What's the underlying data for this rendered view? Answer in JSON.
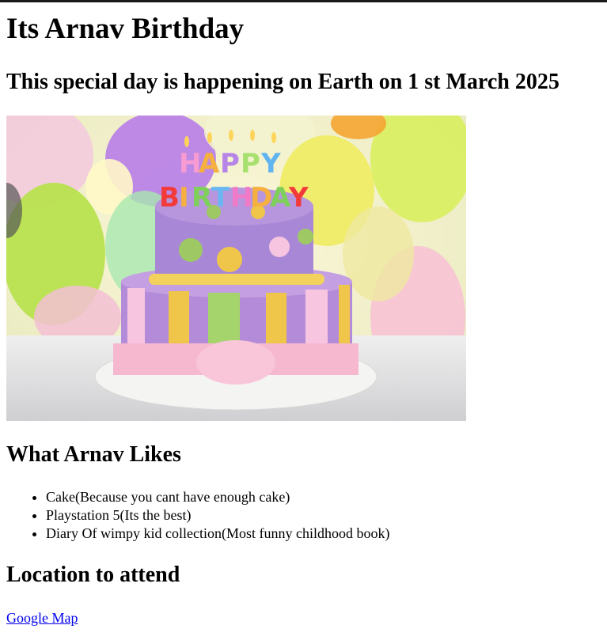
{
  "page": {
    "title": "Its Arnav Birthday",
    "subtitle": "This special day is happening on Earth on 1 st March 2025"
  },
  "image": {
    "icon": "birthday-cake-photo",
    "topper_text": "HAPPY BIRTHDAY"
  },
  "likes": {
    "heading": "What Arnav Likes",
    "items": [
      "Cake(Because you cant have enough cake)",
      "Playstation 5(Its the best)",
      "Diary Of wimpy kid collection(Most funny childhood book)"
    ]
  },
  "location": {
    "heading": "Location to attend",
    "link_label": "Google Map"
  },
  "colors": {
    "text": "#000000",
    "link": "#0000ee",
    "top_border": "#1a1a1a"
  }
}
